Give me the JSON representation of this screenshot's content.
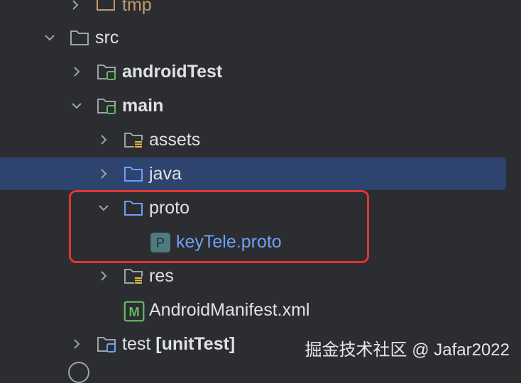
{
  "tree": {
    "items": [
      {
        "label": "tmp",
        "icon": "folder-icon"
      },
      {
        "label": "src",
        "icon": "folder-icon"
      },
      {
        "label": "androidTest",
        "icon": "test-source-folder-icon"
      },
      {
        "label": "main",
        "icon": "source-folder-icon"
      },
      {
        "label": "assets",
        "icon": "resource-folder-icon"
      },
      {
        "label": "java",
        "icon": "folder-icon"
      },
      {
        "label": "proto",
        "icon": "folder-icon"
      },
      {
        "label": "keyTele.proto",
        "icon": "proto-file-icon",
        "glyph": "P"
      },
      {
        "label": "res",
        "icon": "resource-folder-icon"
      },
      {
        "label": "AndroidManifest.xml",
        "icon": "manifest-file-icon",
        "glyph": "M"
      },
      {
        "label": "test [unitTest]",
        "icon": "test-source-folder-icon"
      }
    ]
  },
  "watermark": "掘金技术社区 @ Jafar2022",
  "colors": {
    "background": "#2b2d30",
    "selection": "#2e436e",
    "highlight_border": "#e0362f",
    "link_blue": "#6e9ff7"
  }
}
